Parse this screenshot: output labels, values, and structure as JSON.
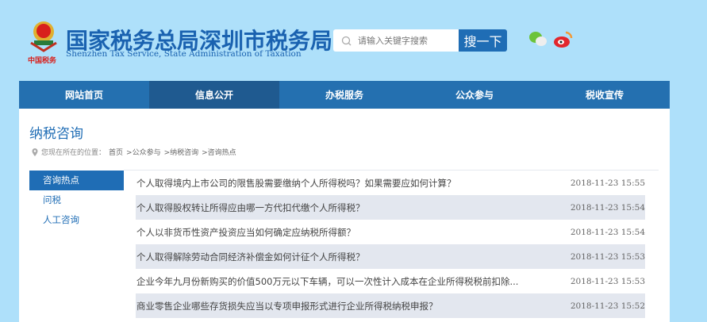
{
  "header": {
    "title": "国家税务总局深圳市税务局",
    "subtitle": "Shenzhen Tax Service, State Administration of Taxation",
    "logo_text": "中国税务",
    "search_placeholder": "请输入关键字搜索",
    "search_button": "搜一下",
    "icons": [
      "wechat-icon",
      "weibo-icon"
    ]
  },
  "nav": [
    {
      "label": "网站首页"
    },
    {
      "label": "信息公开",
      "active": true
    },
    {
      "label": "办税服务"
    },
    {
      "label": "公众参与"
    },
    {
      "label": "税收宣传"
    }
  ],
  "page": {
    "title": "纳税咨询",
    "location_label": "您现在所在的位置：",
    "breadcrumb": [
      "首页",
      ">公众参与",
      ">纳税咨询",
      ">咨询热点"
    ]
  },
  "sidebar": [
    {
      "label": "咨询热点",
      "active": true
    },
    {
      "label": "问税"
    },
    {
      "label": "人工咨询"
    }
  ],
  "list": [
    {
      "title": "个人取得境内上市公司的限售股需要缴纳个人所得税吗？如果需要应如何计算？",
      "date": "2018-11-23 15:55"
    },
    {
      "title": "个人取得股权转让所得应由哪一方代扣代缴个人所得税？",
      "date": "2018-11-23 15:54"
    },
    {
      "title": "个人以非货币性资产投资应当如何确定应纳税所得额？",
      "date": "2018-11-23 15:54"
    },
    {
      "title": "个人取得解除劳动合同经济补偿金如何计征个人所得税？",
      "date": "2018-11-23 15:53"
    },
    {
      "title": "企业今年九月份新购买的价值500万元以下车辆，可以一次性计入成本在企业所得税税前扣除...",
      "date": "2018-11-23 15:53"
    },
    {
      "title": "商业零售企业哪些存货损失应当以专项申报形式进行企业所得税纳税申报？",
      "date": "2018-11-23 15:52"
    }
  ],
  "colors": {
    "background": "#aee0fa",
    "nav": "#2470b0",
    "nav_active": "#1f5a90",
    "accent": "#1f6db5",
    "row_alt": "#e3e7ef"
  }
}
